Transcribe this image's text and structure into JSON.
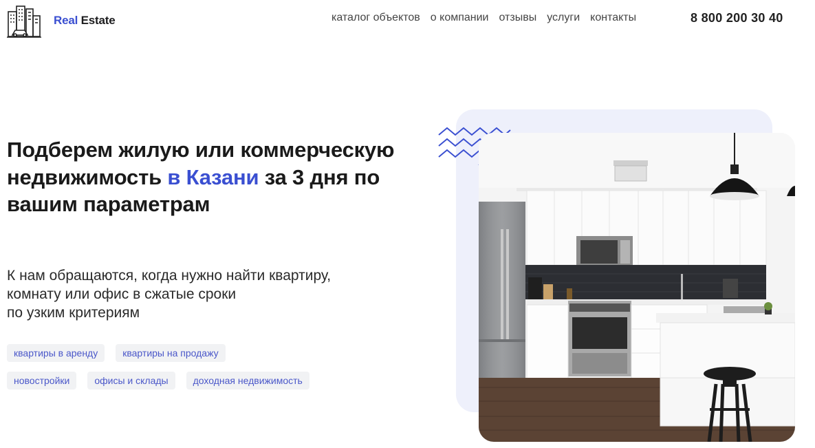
{
  "header": {
    "logo_accent": "Real",
    "logo_rest": "Estate",
    "nav": [
      "каталог объектов",
      "о компании",
      "отзывы",
      "услуги",
      "контакты"
    ],
    "phone": "8 800 200 30 40"
  },
  "hero": {
    "title_part1": "Подберем жилую или коммерческую недвижимость",
    "title_highlight": "в Казани",
    "title_part2": "за 3 дня по вашим параметрам",
    "subtitle_lines": [
      "К нам обращаются, когда нужно найти квартиру,",
      "комнату или офис в сжатые сроки",
      "по узким критериям"
    ],
    "tags_row1": [
      "квартиры в аренду",
      "квартиры на продажу"
    ],
    "tags_row2": [
      "новостройки",
      "офисы и склады",
      "доходная недвижимость"
    ]
  },
  "colors": {
    "accent": "#3a4fd1",
    "tag_bg": "#f1f2f4",
    "panel_bg": "#eef0fb"
  },
  "icons": {
    "logo": "city-buildings-icon",
    "decor": "zigzag-lines-icon"
  }
}
